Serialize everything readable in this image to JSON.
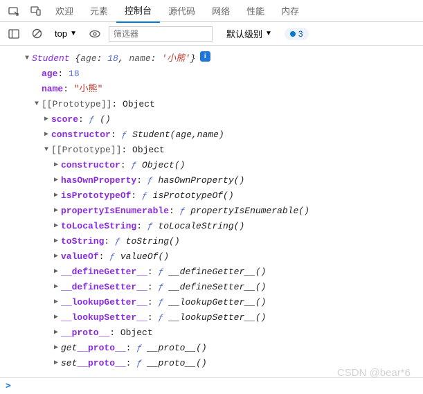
{
  "tabs": {
    "welcome": "欢迎",
    "elements": "元素",
    "console": "控制台",
    "sources": "源代码",
    "network": "网络",
    "performance": "性能",
    "memory": "内存"
  },
  "toolbar": {
    "context": "top",
    "filter_placeholder": "筛选器",
    "level": "默认级别",
    "badge_count": "3"
  },
  "obj": {
    "class": "Student",
    "summary_age_key": "age",
    "summary_age_val": "18",
    "summary_name_key": "name",
    "summary_name_val": "'小熊'",
    "age_key": "age",
    "age_val": "18",
    "name_key": "name",
    "name_val": "\"小熊\"",
    "proto_label": "[[Prototype]]",
    "object_label": "Object",
    "level1": {
      "score_key": "score",
      "score_val": "()",
      "ctor_key": "constructor",
      "ctor_val": "Student(age,name)"
    },
    "level2": [
      {
        "k": "constructor",
        "v": "Object()"
      },
      {
        "k": "hasOwnProperty",
        "v": "hasOwnProperty()"
      },
      {
        "k": "isPrototypeOf",
        "v": "isPrototypeOf()"
      },
      {
        "k": "propertyIsEnumerable",
        "v": "propertyIsEnumerable()"
      },
      {
        "k": "toLocaleString",
        "v": "toLocaleString()"
      },
      {
        "k": "toString",
        "v": "toString()"
      },
      {
        "k": "valueOf",
        "v": "valueOf()"
      },
      {
        "k": "__defineGetter__",
        "v": "__defineGetter__()"
      },
      {
        "k": "__defineSetter__",
        "v": "__defineSetter__()"
      },
      {
        "k": "__lookupGetter__",
        "v": "__lookupGetter__()"
      },
      {
        "k": "__lookupSetter__",
        "v": "__lookupSetter__()"
      }
    ],
    "proto_key2": "__proto__",
    "get_label": "get ",
    "set_label": "set ",
    "proto_accessor_key": "__proto__",
    "proto_accessor_val": "__proto__()"
  },
  "f_glyph": "ƒ",
  "watermark": "CSDN @bear*6"
}
